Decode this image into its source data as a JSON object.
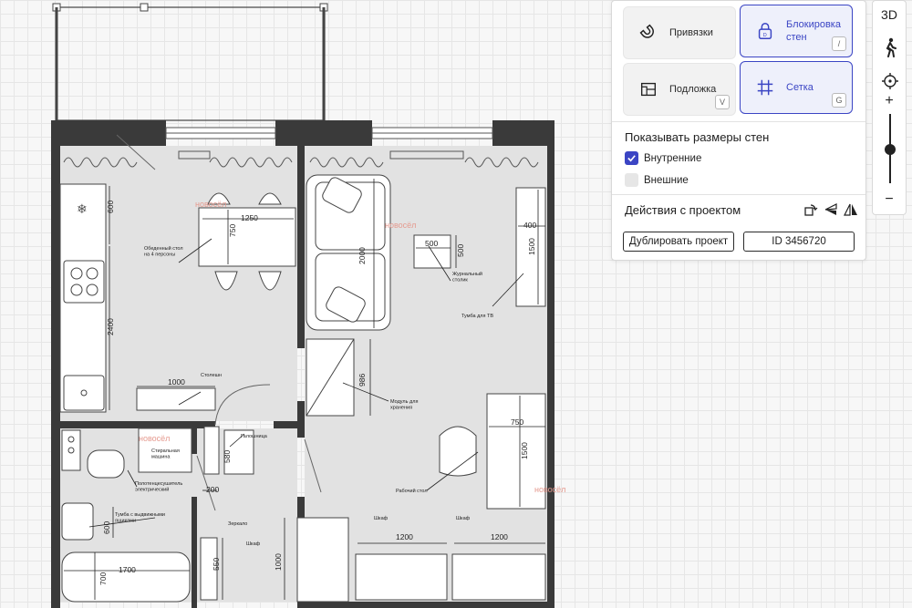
{
  "plan": {
    "dims": {
      "d1250": "1250",
      "d750a": "750",
      "d600a": "600",
      "d2400": "2400",
      "d1000a": "1000",
      "d2000": "2000",
      "d500a": "500",
      "d500b": "500",
      "d400": "400",
      "d1500a": "1500",
      "d986": "986",
      "d580": "580",
      "d200": "200",
      "d600b": "600",
      "d700": "700",
      "d1700": "1700",
      "d550": "550",
      "d1000b": "1000",
      "d750b": "750",
      "d1500b": "1500",
      "d1200a": "1200",
      "d1200b": "1200"
    },
    "labels": {
      "dining_table": "Обеденный стол\nна 4 персоны",
      "coffee_table": "Журнальный\nстолик",
      "tv_stand": "Тумба для ТВ",
      "storage": "Модуль для\nхранения",
      "countertop": "Столешн",
      "washer": "Стиральная\nмашина",
      "towel_dryer": "Полотенцесушитель\nэлектрический",
      "drawer_stand": "Тумба с выдвижными\nящиками",
      "shoe_rack": "Галошница",
      "mirror": "Зеркало",
      "wardrobe_hall": "Шкаф",
      "desk": "Рабочий стол",
      "wardrobe1": "Шкаф",
      "wardrobe2": "Шкаф"
    },
    "watermark": "новосёл"
  },
  "panel": {
    "snaps": {
      "label": "Привязки"
    },
    "wall_lock": {
      "label": "Блокировка\nстен",
      "key": "/",
      "inner": "D"
    },
    "underlay": {
      "label": "Подложка",
      "key": "V"
    },
    "grid": {
      "label": "Сетка",
      "key": "G"
    },
    "wall_sizes_title": "Показывать размеры стен",
    "internal": {
      "label": "Внутренние",
      "checked": true
    },
    "external": {
      "label": "Внешние",
      "checked": false
    },
    "actions_title": "Действия с проектом",
    "duplicate_button": "Дублировать проект",
    "project_id": "ID 3456720"
  },
  "view_toolbar": {
    "mode_3d": "3D",
    "plus": "+",
    "minus": "−",
    "zoom_level": 0.5
  },
  "colors": {
    "accent": "#3b45c4",
    "wall": "#3a3a3a",
    "floor": "#e2e2e2",
    "watermark": "#e59a8f"
  }
}
